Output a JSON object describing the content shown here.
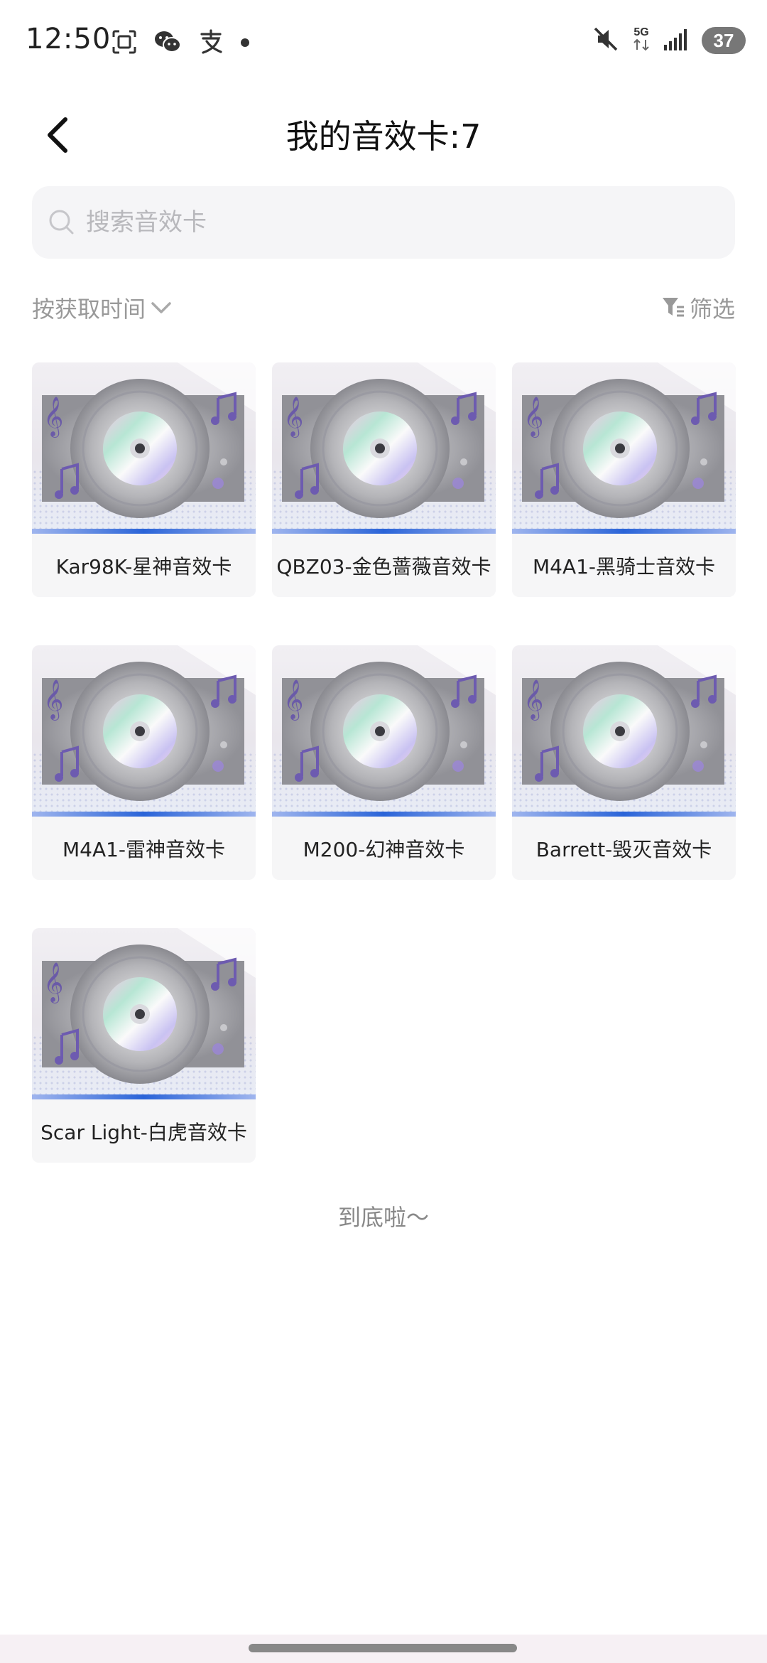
{
  "status_bar": {
    "time": "12:50",
    "network": "5G",
    "battery": "37",
    "left_icons": [
      "screenshot-icon",
      "wechat-icon",
      "alipay-icon",
      "dot-icon"
    ],
    "right_icons": [
      "mute-icon",
      "network-5g-icon",
      "signal-icon",
      "battery-icon"
    ]
  },
  "header": {
    "back_icon": "back-arrow-icon",
    "title": "我的音效卡:7"
  },
  "search": {
    "placeholder": "搜索音效卡",
    "value": ""
  },
  "sort_bar": {
    "sort_label": "按获取时间",
    "filter_label": "筛选"
  },
  "cards": [
    {
      "label": "Kar98K-星神音效卡"
    },
    {
      "label": "QBZ03-金色蔷薇音效卡"
    },
    {
      "label": "M4A1-黑骑士音效卡"
    },
    {
      "label": "M4A1-雷神音效卡"
    },
    {
      "label": "M200-幻神音效卡"
    },
    {
      "label": "Barrett-毁灭音效卡"
    },
    {
      "label": "Scar Light-白虎音效卡"
    }
  ],
  "footer": {
    "end_text": "到底啦～"
  },
  "colors": {
    "accent_blue": "#2a64d8",
    "search_bg": "#f5f5f7",
    "card_bg": "#f4f4f6"
  }
}
